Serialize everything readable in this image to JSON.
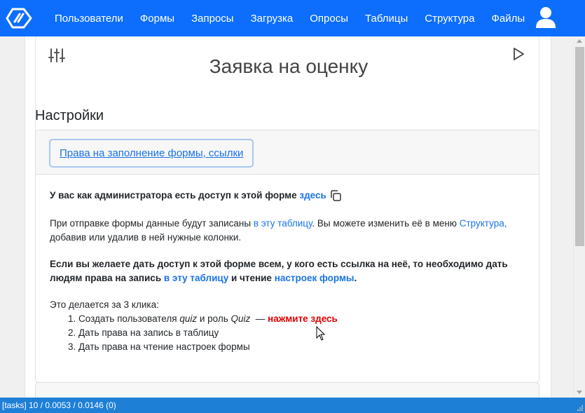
{
  "navbar": {
    "items": [
      "Пользователи",
      "Формы",
      "Запросы",
      "Загрузка",
      "Опросы",
      "Таблицы",
      "Структура",
      "Файлы"
    ],
    "logo_icon": "logo-icon",
    "user_icon": "user-icon",
    "color": "#0d6efd"
  },
  "form": {
    "title": "Заявка на оценку",
    "settings_icon": "sliders-icon",
    "run_icon": "play-icon"
  },
  "settings": {
    "title": "Настройки",
    "tab_label": "Права на заполнение формы, ссылки",
    "admin_text": "У вас как администратора есть доступ к этой форме ",
    "admin_link": "здесь",
    "data_text_1": "При отправке формы данные будут записаны ",
    "data_link_1": "в эту таблицу",
    "data_text_2": ". Вы можете изменить её в меню ",
    "data_link_2": "Структура,",
    "data_text_3": " добавив или удалив в ней нужные колонки.",
    "access_text_1": "Если вы желаете дать доступ к этой форме всем, у кого есть ссылка на неё, то необходимо дать людям права на запись ",
    "access_link_1": "в эту таблицу",
    "access_text_2": " и чтение ",
    "access_link_2": "настроек формы",
    "access_text_3": ".",
    "steps_intro": "Это делается за 3 клика:",
    "step1_prefix": "1. Создать пользователя ",
    "step1_user": "quiz",
    "step1_middle": " и роль ",
    "step1_role": "Quiz",
    "step1_dash": "  — ",
    "step1_action": "нажмите здесь",
    "step2": "2. Дать права на запись в таблицу",
    "step3": "3. Дать права на чтение настроек формы"
  },
  "status_bar": {
    "text": "[tasks] 10 / 0.0053 / 0.0146 (0)"
  },
  "colors": {
    "link": "#1a73e8",
    "action": "#e00000",
    "status_bar": "#1e7fd6"
  }
}
